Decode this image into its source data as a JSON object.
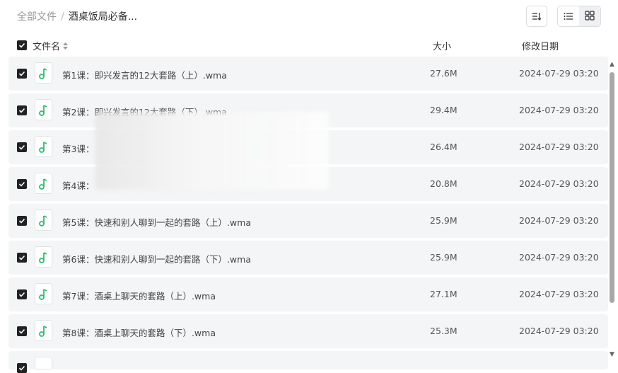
{
  "breadcrumb": {
    "root": "全部文件",
    "separator": "/",
    "current": "酒桌饭局必备..."
  },
  "toolbar": {
    "sort_icon": "sort-lines-icon",
    "list_view_icon": "list-view-icon",
    "grid_view_icon": "grid-view-icon"
  },
  "columns": {
    "name": "文件名",
    "size": "大小",
    "modified": "修改日期"
  },
  "files": [
    {
      "name": "第1课：即兴发言的12大套路（上）.wma",
      "size": "27.6M",
      "modified": "2024-07-29 03:20"
    },
    {
      "name": "第2课：即兴发言的12大套路（下）.wma",
      "size": "29.4M",
      "modified": "2024-07-29 03:20"
    },
    {
      "name": "第3课：",
      "size": "26.4M",
      "modified": "2024-07-29 03:20"
    },
    {
      "name": "第4课：",
      "size": "20.8M",
      "modified": "2024-07-29 03:20"
    },
    {
      "name": "第5课：快速和别人聊到一起的套路（上）.wma",
      "size": "25.9M",
      "modified": "2024-07-29 03:20"
    },
    {
      "name": "第6课：快速和别人聊到一起的套路（下）.wma",
      "size": "25.9M",
      "modified": "2024-07-29 03:20"
    },
    {
      "name": "第7课：酒桌上聊天的套路（上）.wma",
      "size": "27.1M",
      "modified": "2024-07-29 03:20"
    },
    {
      "name": "第8课：酒桌上聊天的套路（下）.wma",
      "size": "25.3M",
      "modified": "2024-07-29 03:20"
    }
  ],
  "colors": {
    "music_icon": "#2dbd6e",
    "row_bg": "#f4f5f6",
    "checkbox": "#222222"
  }
}
